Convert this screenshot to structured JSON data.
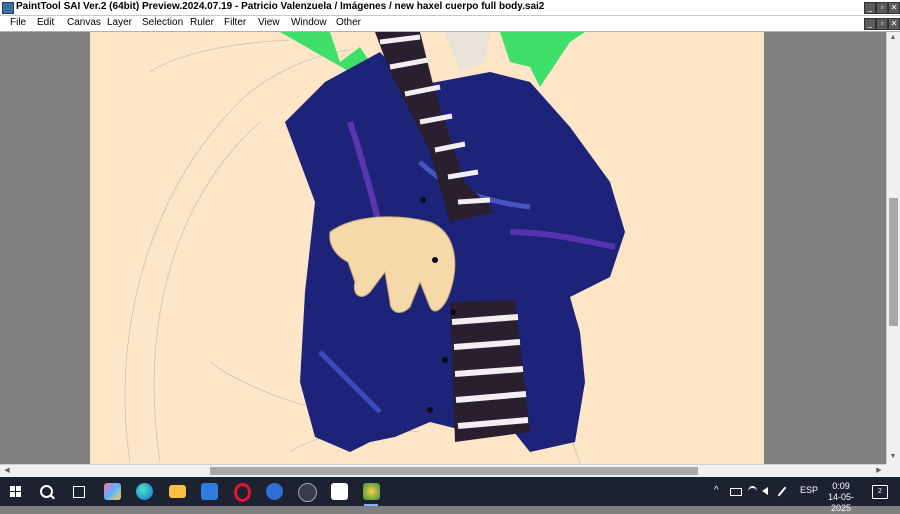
{
  "window": {
    "title": "PaintTool SAI Ver.2 (64bit) Preview.2024.07.19 - Patricio Valenzuela / Imágenes / new haxel cuerpo full body.sai2",
    "min": "_",
    "max": "▫",
    "close": "✕"
  },
  "menu": {
    "items": [
      "File",
      "Edit",
      "Canvas",
      "Layer",
      "Selection",
      "Ruler",
      "Filter",
      "View",
      "Window",
      "Other"
    ]
  },
  "scroll": {
    "up": "▲",
    "down": "▼",
    "left": "◀",
    "right": "▶"
  },
  "taskbar": {
    "start_icon": "windows-icon",
    "search_icon": "search-icon",
    "taskview_icon": "task-view-icon",
    "apps": [
      "copilot-icon",
      "edge-icon",
      "file-explorer-icon",
      "store-icon",
      "opera-icon",
      "qbittorrent-icon",
      "obs-icon",
      "ibis-paint-icon",
      "painttool-sai-icon"
    ],
    "tray": {
      "chevron": "^",
      "lang": "ESP"
    },
    "time": "0:09",
    "date": "14-05-2025",
    "notifications": "2"
  },
  "colors": {
    "canvas_bg": "#fde6c8",
    "jacket": "#1e237a",
    "hair": "#3ee06a",
    "taskbar": "#1c2230"
  }
}
